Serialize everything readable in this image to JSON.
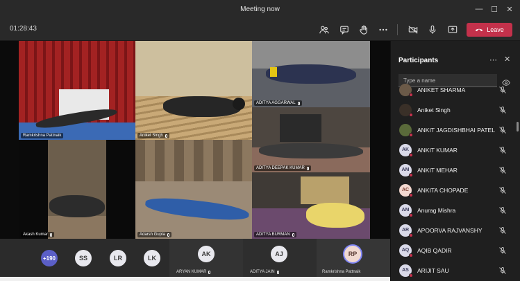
{
  "window": {
    "title": "Meeting now"
  },
  "toolbar": {
    "timer": "01:28:43",
    "leave_label": "Leave"
  },
  "tiles": [
    {
      "name": "Ramkrishna Pattnaik"
    },
    {
      "name": "Aniket Singh"
    },
    {
      "name": "ADITYA AGGARWAL"
    },
    {
      "name": "ADITYA DEEPAK KUMAR"
    },
    {
      "name": "Akash Kumar"
    },
    {
      "name": "Adarsh Gupta"
    },
    {
      "name": "ADITYA BURMAN"
    }
  ],
  "strip": {
    "more_count": "+190",
    "avatars": [
      "SS",
      "LR",
      "LK"
    ],
    "panels": [
      {
        "initials": "AK",
        "name": "ARYAN KUMAR"
      },
      {
        "initials": "AJ",
        "name": "ADITYA JAIN"
      },
      {
        "initials": "RP",
        "name": "Ramkrishna Pattnaik"
      }
    ]
  },
  "participants": {
    "title": "Participants",
    "search_placeholder": "Type a name",
    "items": [
      {
        "initials": "",
        "name": "ANIKET SHARMA"
      },
      {
        "initials": "",
        "name": "Aniket Singh"
      },
      {
        "initials": "",
        "name": "ANKIT JAGDISHBHAI PATEL"
      },
      {
        "initials": "AK",
        "name": "ANKIT KUMAR"
      },
      {
        "initials": "AM",
        "name": "ANKIT MEHAR"
      },
      {
        "initials": "AC",
        "name": "ANKITA CHOPADE"
      },
      {
        "initials": "AM",
        "name": "Anurag Mishra"
      },
      {
        "initials": "AR",
        "name": "APOORVA RAJVANSHY"
      },
      {
        "initials": "AQ",
        "name": "AQIB QADIR"
      },
      {
        "initials": "AS",
        "name": "ARIJIT SAU"
      }
    ]
  },
  "colors": {
    "leave": "#c4314b",
    "accent": "#5b5fc7",
    "status_dot": "#c4314b"
  }
}
